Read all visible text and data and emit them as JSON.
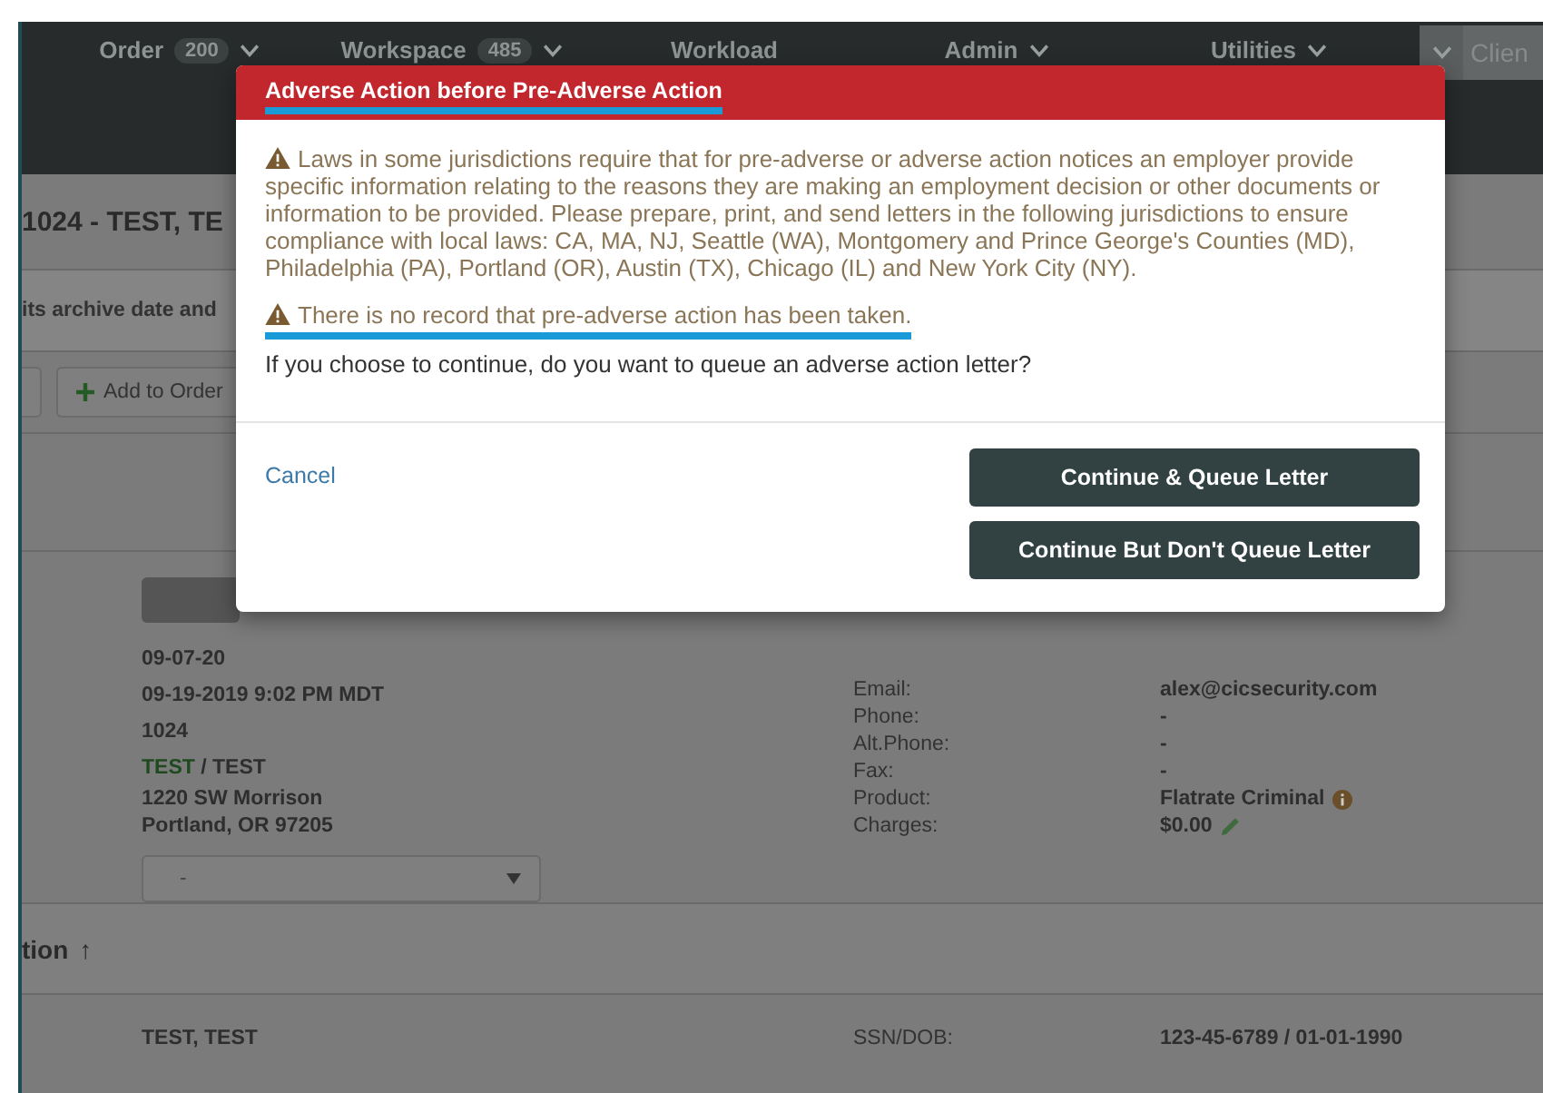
{
  "nav": {
    "items": [
      {
        "label": "Order",
        "badge": "200",
        "has_caret": true
      },
      {
        "label": "Workspace",
        "badge": "485",
        "has_caret": true
      },
      {
        "label": "Workload",
        "has_caret": false
      },
      {
        "label": "Admin",
        "has_caret": true
      },
      {
        "label": "Utilities",
        "has_caret": true
      }
    ],
    "client_search": {
      "placeholder": "Clien"
    }
  },
  "page": {
    "title": "1024 - TEST, TE",
    "notice": "its archive date and",
    "toolbar": {
      "add_button": "Add to Order"
    }
  },
  "order": {
    "dates": [
      "09-07-20",
      "09-19-2019 9:02 PM MDT"
    ],
    "number": "1024",
    "client_name": "TEST",
    "separator": "/",
    "client_contact": "TEST",
    "address": [
      "1220 SW Morrison",
      "Portland, OR 97205"
    ],
    "select": {
      "value": "-"
    },
    "fields": [
      {
        "label": "Email:",
        "value": "alex@cicsecurity.com",
        "kind": "link"
      },
      {
        "label": "Phone:",
        "value": "-",
        "kind": "text"
      },
      {
        "label": "Alt.Phone:",
        "value": "-",
        "kind": "text"
      },
      {
        "label": "Fax:",
        "value": "-",
        "kind": "text"
      },
      {
        "label": "Product:",
        "value": "Flatrate Criminal",
        "kind": "info"
      },
      {
        "label": "Charges:",
        "value": "$0.00",
        "kind": "editable"
      }
    ]
  },
  "section": {
    "title": "tion",
    "sort": "↑"
  },
  "subject": {
    "name": "TEST, TEST",
    "fields": [
      {
        "label": "SSN/DOB:",
        "value": "123-45-6789 / 01-01-1990"
      }
    ]
  },
  "modal": {
    "title": "Adverse Action before Pre-Adverse Action",
    "title_underlined": true,
    "warning": "Laws in some jurisdictions require that for pre-adverse or adverse action notices an employer provide specific information relating to the reasons they are making an employment decision or other documents or information to be provided. Please prepare, print, and send letters in the following jurisdictions to ensure compliance with local laws: CA, MA, NJ, Seattle (WA), Montgomery and Prince George's Counties (MD), Philadelphia (PA), Portland (OR), Austin (TX), Chicago (IL) and New York City (NY).",
    "notice": "There is no record that pre-adverse action has been taken.",
    "notice_underlined": true,
    "question": "If you choose to continue, do you want to queue an adverse action letter?",
    "cancel": "Cancel",
    "buttons": [
      "Continue & Queue Letter",
      "Continue But Don't Queue Letter"
    ]
  }
}
